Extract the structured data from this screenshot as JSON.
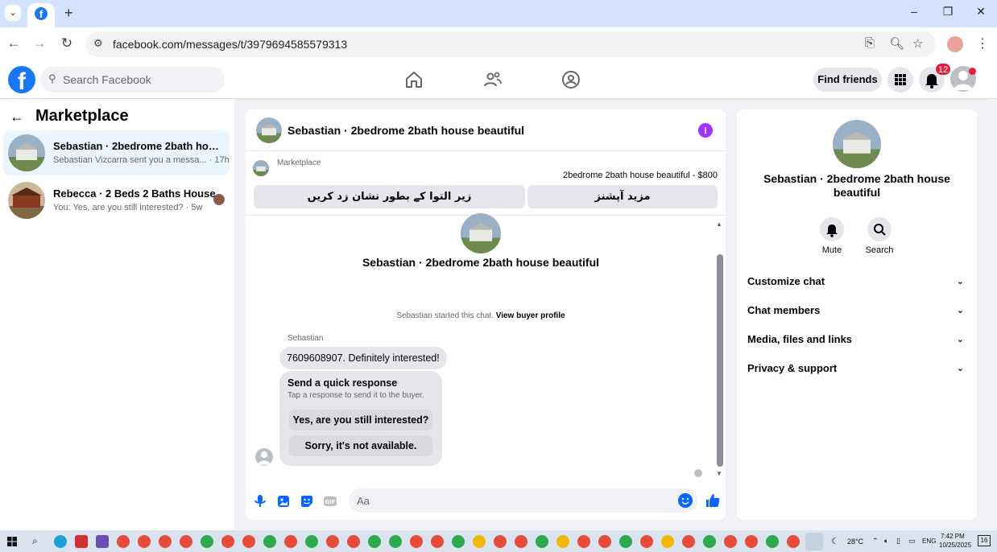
{
  "browser": {
    "url": "facebook.com/messages/t/3979694585579313",
    "controls": {
      "minimize": "–",
      "restore": "❐",
      "close": "✕",
      "new_tab": "+",
      "tab_dropdown": "⌄"
    }
  },
  "fb_header": {
    "search_placeholder": "Search Facebook",
    "find_friends_label": "Find friends",
    "notification_count": "12"
  },
  "left_panel": {
    "title": "Marketplace",
    "conversations": [
      {
        "name": "Sebastian · 2bedrome 2bath house...",
        "preview": "Sebastian Vizcarra sent you a messa... · 17h"
      },
      {
        "name": "Rebecca · 2 Beds 2 Baths House",
        "preview": "You: Yes, are you still interested? · 5w"
      }
    ]
  },
  "chat": {
    "header_name": "Sebastian · 2bedrome 2bath house beautiful",
    "marketplace_label": "Marketplace",
    "listing": "2bedrome 2bath house beautiful - $800",
    "btn_mark_pending": "زیر التوا کے بطور نشان زد کریں",
    "btn_more_options": "مزید آپشنز",
    "intro_name": "Sebastian · 2bedrome 2bath house beautiful",
    "started_text": "Sebastian started this chat.",
    "view_buyer_profile": "View buyer profile",
    "sender": "Sebastian",
    "message": "7609608907. Definitely interested!",
    "quick_response_title": "Send a quick response",
    "quick_response_sub": "Tap a response to send it to the buyer.",
    "quick_responses": [
      "Yes, are you still interested?",
      "Sorry, it's not available."
    ],
    "composer_placeholder": "Aa"
  },
  "right_panel": {
    "name": "Sebastian · 2bedrome 2bath house beautiful",
    "actions": [
      {
        "label": "Mute"
      },
      {
        "label": "Search"
      }
    ],
    "sections": [
      "Customize chat",
      "Chat members",
      "Media, files and links",
      "Privacy & support"
    ]
  },
  "taskbar": {
    "weather": "28°C",
    "language": "ENG",
    "time": "7:42 PM",
    "date": "10/25/2025",
    "notif_count": "16"
  },
  "colors": {
    "fb_blue": "#1877f2",
    "messenger_blue": "#0866ff",
    "info_purple": "#a033ff",
    "badge_red": "#e41e3f"
  }
}
